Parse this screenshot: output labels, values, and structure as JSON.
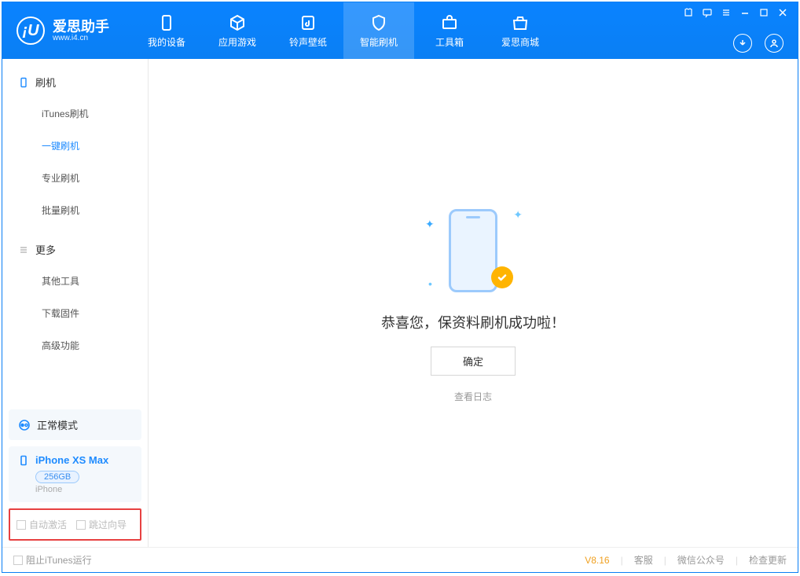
{
  "app": {
    "title": "爱思助手",
    "subtitle": "www.i4.cn"
  },
  "nav": {
    "tabs": [
      {
        "label": "我的设备",
        "icon": "device"
      },
      {
        "label": "应用游戏",
        "icon": "cube"
      },
      {
        "label": "铃声壁纸",
        "icon": "music"
      },
      {
        "label": "智能刷机",
        "icon": "shield",
        "active": true
      },
      {
        "label": "工具箱",
        "icon": "toolbox"
      },
      {
        "label": "爱思商城",
        "icon": "store"
      }
    ]
  },
  "sidebar": {
    "section1": {
      "title": "刷机",
      "items": [
        {
          "label": "iTunes刷机"
        },
        {
          "label": "一键刷机",
          "active": true
        },
        {
          "label": "专业刷机"
        },
        {
          "label": "批量刷机"
        }
      ]
    },
    "section2": {
      "title": "更多",
      "items": [
        {
          "label": "其他工具"
        },
        {
          "label": "下载固件"
        },
        {
          "label": "高级功能"
        }
      ]
    },
    "status": "正常模式",
    "device": {
      "name": "iPhone XS Max",
      "storage": "256GB",
      "type": "iPhone"
    },
    "opts": {
      "auto_activate": "自动激活",
      "skip_guide": "跳过向导"
    }
  },
  "main": {
    "success_text": "恭喜您，保资料刷机成功啦！",
    "confirm_label": "确定",
    "log_link": "查看日志"
  },
  "footer": {
    "block_itunes": "阻止iTunes运行",
    "version": "V8.16",
    "links": [
      "客服",
      "微信公众号",
      "检查更新"
    ]
  }
}
